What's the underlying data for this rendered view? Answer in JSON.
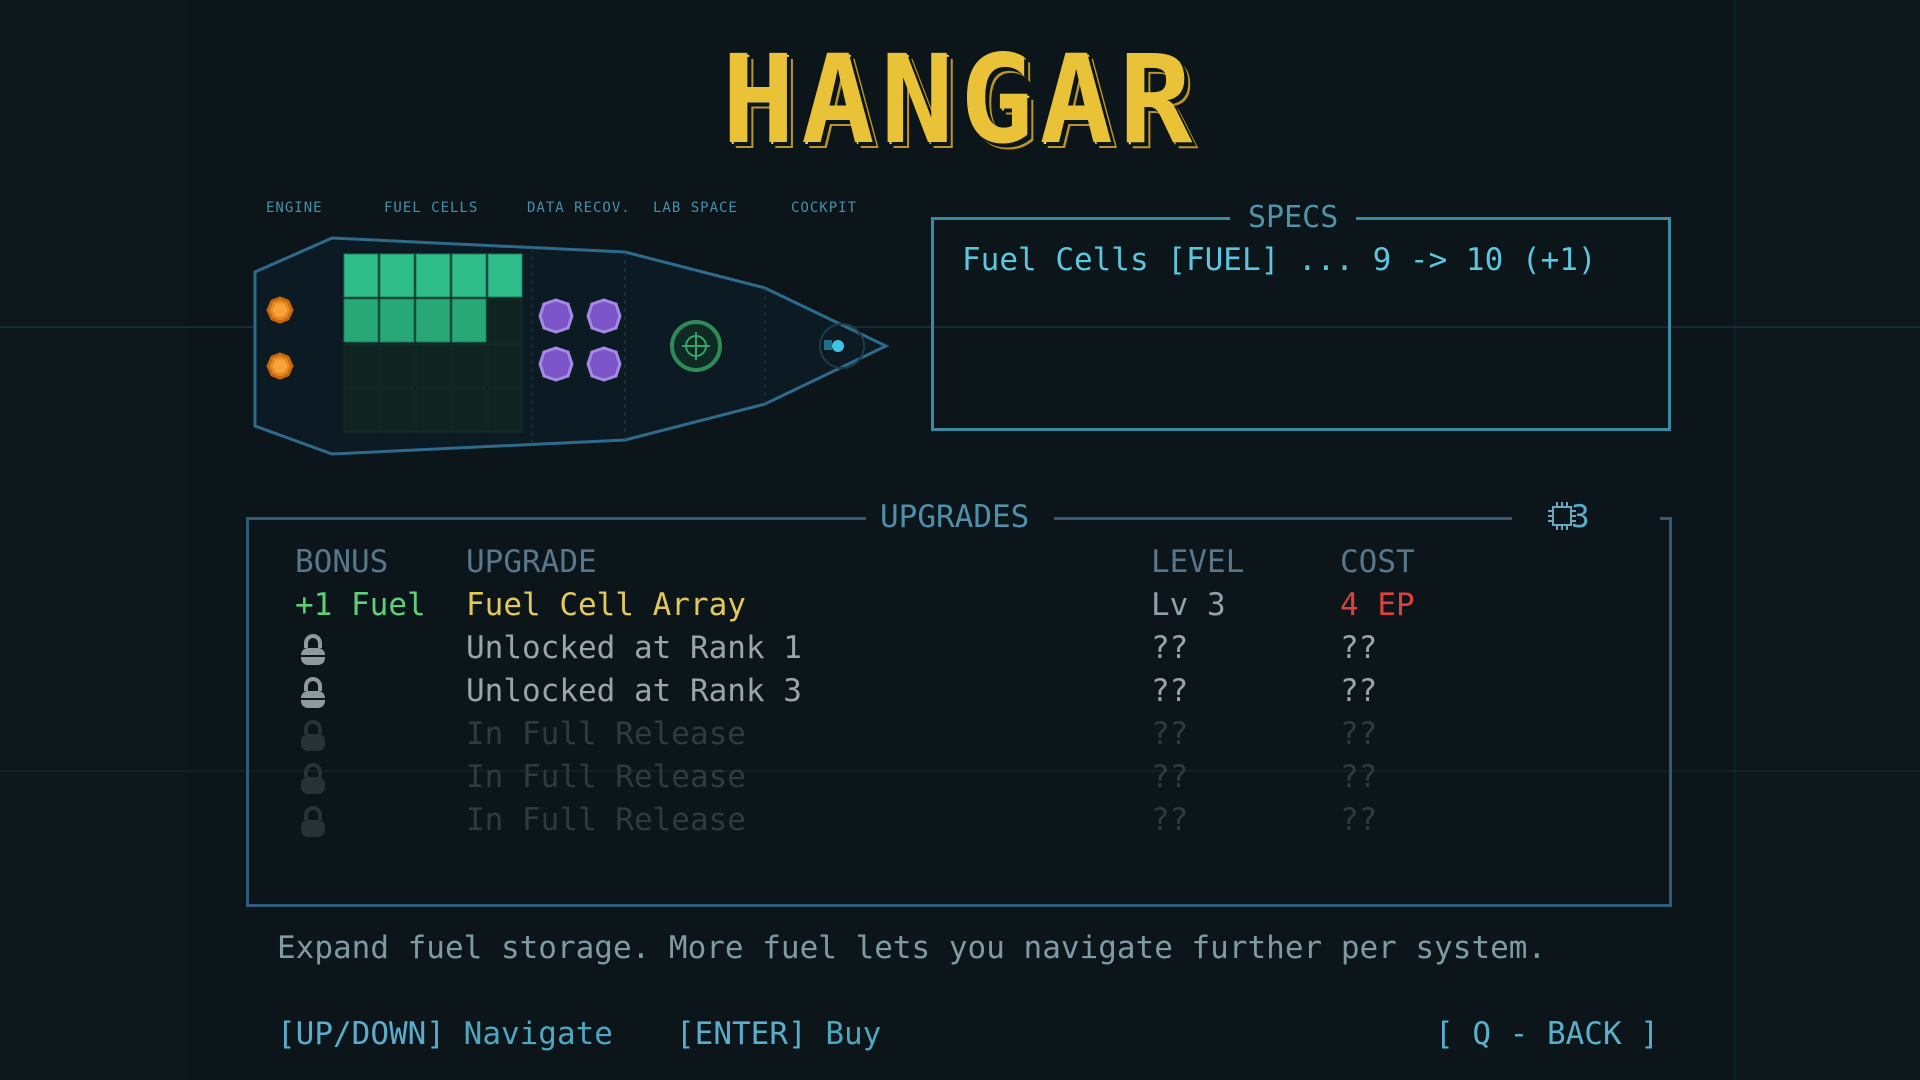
{
  "title": "HANGAR",
  "ship": {
    "sections": [
      "ENGINE",
      "FUEL CELLS",
      "DATA RECOV.",
      "LAB SPACE",
      "COCKPIT"
    ],
    "fuel_cells_filled": 9,
    "fuel_cells_total": 20,
    "engine_modules": 2,
    "data_modules": 4
  },
  "specs": {
    "title": "SPECS",
    "text": "Fuel Cells [FUEL] ... 9 -> 10 (+1)"
  },
  "upgrades": {
    "title": "UPGRADES",
    "ep": "3",
    "headers": {
      "bonus": "BONUS",
      "upgrade": "UPGRADE",
      "level": "LEVEL",
      "cost": "COST"
    },
    "rows": [
      {
        "bonus": "+1 Fuel",
        "name": "Fuel Cell Array",
        "level": "Lv 3",
        "cost": "4 EP"
      },
      {
        "bonus": "",
        "name": "Unlocked at Rank 1",
        "level": "??",
        "cost": "??"
      },
      {
        "bonus": "",
        "name": "Unlocked at Rank 3",
        "level": "??",
        "cost": "??"
      },
      {
        "bonus": "",
        "name": "In Full Release",
        "level": "??",
        "cost": "??"
      },
      {
        "bonus": "",
        "name": "In Full Release",
        "level": "??",
        "cost": "??"
      },
      {
        "bonus": "",
        "name": "In Full Release",
        "level": "??",
        "cost": "??"
      }
    ]
  },
  "description": "Expand fuel storage. More fuel lets you navigate further per system.",
  "footer": {
    "nav_key": "[UP/DOWN]",
    "nav_label": "Navigate",
    "buy_key": "[ENTER]",
    "buy_label": "Buy",
    "back": "[ Q - BACK ]"
  },
  "colors": {
    "title": "#e9c238",
    "selected_bonus": "#5fd07a",
    "selected_name": "#e3c85a",
    "cost_red": "#e0403c",
    "locked_text": "#9aa5a8",
    "faded_text": "#2e3b3e",
    "accent": "#3b8aa2"
  },
  "icons": {
    "ep": "chip-icon",
    "locked": "lock-icon"
  }
}
